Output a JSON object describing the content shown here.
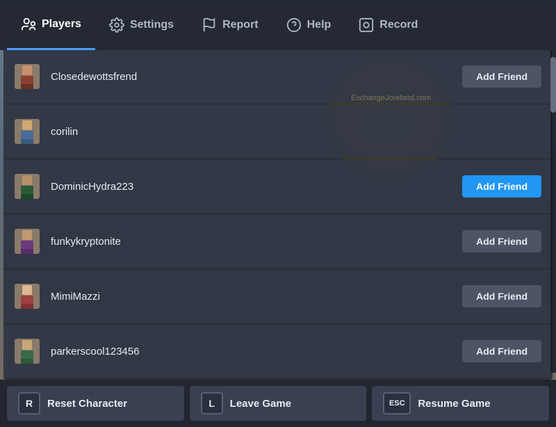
{
  "nav": {
    "items": [
      {
        "id": "players",
        "label": "Players",
        "active": true
      },
      {
        "id": "settings",
        "label": "Settings",
        "active": false
      },
      {
        "id": "report",
        "label": "Report",
        "active": false
      },
      {
        "id": "help",
        "label": "Help",
        "active": false
      },
      {
        "id": "record",
        "label": "Record",
        "active": false
      }
    ]
  },
  "players": {
    "list": [
      {
        "name": "Closedewottsfrend",
        "hasAddFriend": true,
        "friendBtnHighlighted": false
      },
      {
        "name": "corilin",
        "hasAddFriend": false,
        "friendBtnHighlighted": false
      },
      {
        "name": "DominicHydra223",
        "hasAddFriend": true,
        "friendBtnHighlighted": true
      },
      {
        "name": "funkykryptonite",
        "hasAddFriend": true,
        "friendBtnHighlighted": false
      },
      {
        "name": "MimiMazzi",
        "hasAddFriend": true,
        "friendBtnHighlighted": false
      },
      {
        "name": "parkerscool123456",
        "hasAddFriend": true,
        "friendBtnHighlighted": false
      }
    ],
    "addFriendLabel": "Add Friend"
  },
  "bottomBar": {
    "buttons": [
      {
        "key": "R",
        "label": "Reset Character",
        "id": "reset"
      },
      {
        "key": "L",
        "label": "Leave Game",
        "id": "leave"
      },
      {
        "key": "ESC",
        "label": "Resume Game",
        "id": "resume"
      }
    ]
  },
  "watermark": "ExchangeJoreland.com"
}
